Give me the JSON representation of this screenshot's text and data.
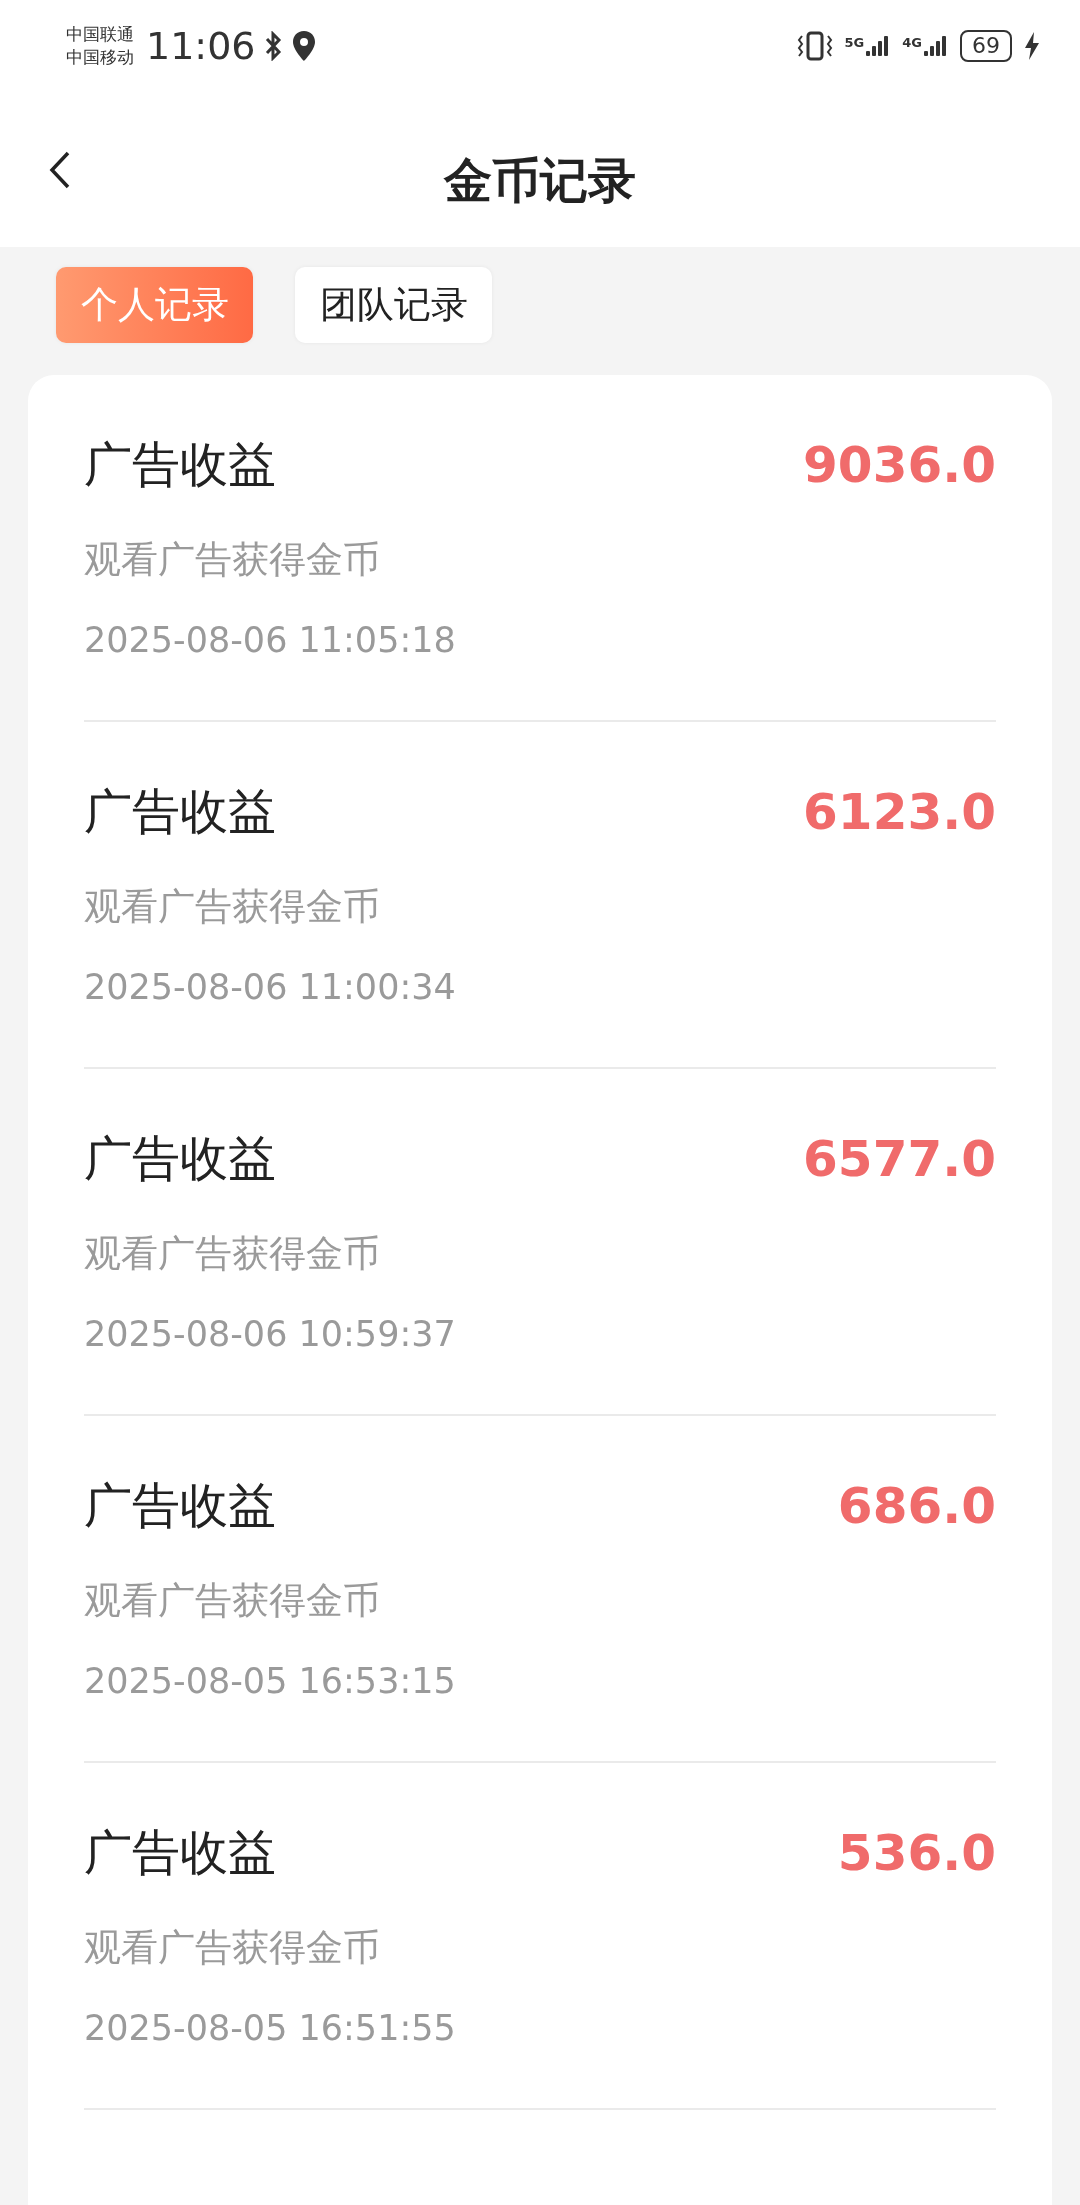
{
  "status_bar": {
    "carriers": [
      "中国联通",
      "中国移动"
    ],
    "time": "11:06",
    "network_1": "5G",
    "network_2": "4G",
    "battery": "69"
  },
  "header": {
    "title": "金币记录"
  },
  "tabs": [
    {
      "label": "个人记录",
      "selected": true
    },
    {
      "label": "团队记录",
      "selected": false
    }
  ],
  "records": [
    {
      "title": "广告收益",
      "description": "观看广告获得金币",
      "time": "2025-08-06 11:05:18",
      "amount": "9036.0"
    },
    {
      "title": "广告收益",
      "description": "观看广告获得金币",
      "time": "2025-08-06 11:00:34",
      "amount": "6123.0"
    },
    {
      "title": "广告收益",
      "description": "观看广告获得金币",
      "time": "2025-08-06 10:59:37",
      "amount": "6577.0"
    },
    {
      "title": "广告收益",
      "description": "观看广告获得金币",
      "time": "2025-08-05 16:53:15",
      "amount": "686.0"
    },
    {
      "title": "广告收益",
      "description": "观看广告获得金币",
      "time": "2025-08-05 16:51:55",
      "amount": "536.0"
    }
  ]
}
